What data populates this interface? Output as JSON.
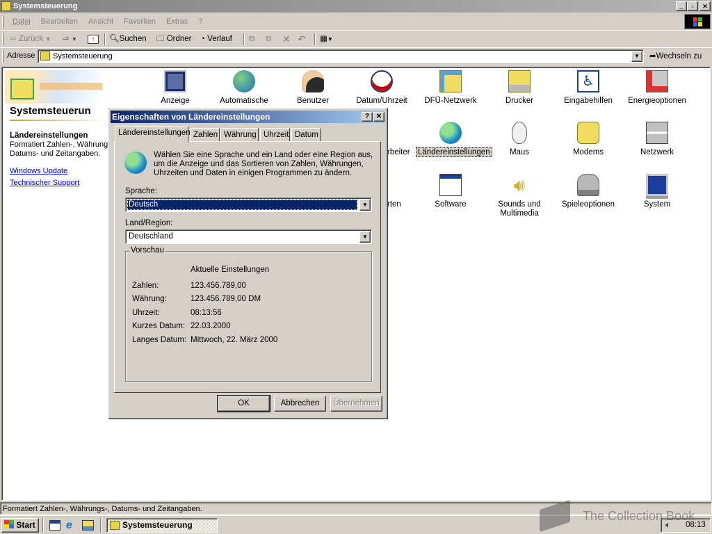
{
  "window": {
    "title": "Systemsteuerung"
  },
  "menu": [
    "Datei",
    "Bearbeiten",
    "Ansicht",
    "Favoriten",
    "Extras",
    "?"
  ],
  "toolbar": {
    "back": "Zurück",
    "search": "Suchen",
    "folders": "Ordner",
    "history": "Verlauf"
  },
  "address": {
    "label": "Adresse",
    "value": "Systemsteuerung",
    "go": "Wechseln zu"
  },
  "left_panel": {
    "title": "Systemsteuerun",
    "selected_name": "Ländereinstellungen",
    "selected_desc": "Formatiert Zahlen-, Währung Datums- und Zeitangaben.",
    "links": [
      "Windows Update",
      "Technischer Support"
    ]
  },
  "icons": [
    {
      "label": "Anzeige",
      "icon": "display-icon"
    },
    {
      "label": "Automatische Updates",
      "icon": "auto-updates-icon"
    },
    {
      "label": "Benutzer",
      "icon": "users-icon"
    },
    {
      "label": "Datum/Uhrzeit",
      "icon": "calendar-clock-icon"
    },
    {
      "label": "DFÜ-Netzwerk",
      "icon": "dialup-network-icon"
    },
    {
      "label": "Drucker",
      "icon": "printer-icon"
    },
    {
      "label": "Eingabehilfen",
      "icon": "accessibility-icon"
    },
    {
      "label": "Energieoptionen",
      "icon": "power-icon"
    },
    {
      "label": "…rbeiter",
      "icon": "hidden-icon"
    },
    {
      "label": "Ländereinstellungen",
      "icon": "globe-icon"
    },
    {
      "label": "Maus",
      "icon": "mouse-icon"
    },
    {
      "label": "Modems",
      "icon": "modem-icon"
    },
    {
      "label": "Netzwerk",
      "icon": "network-icon"
    },
    {
      "label": "…rten",
      "icon": "hidden-icon"
    },
    {
      "label": "Software",
      "icon": "software-icon"
    },
    {
      "label": "Sounds und Multimedia",
      "icon": "speaker-icon"
    },
    {
      "label": "Spieleoptionen",
      "icon": "joystick-icon"
    },
    {
      "label": "System",
      "icon": "computer-icon"
    }
  ],
  "dialog": {
    "title": "Eigenschaften von Ländereinstellungen",
    "tabs": [
      "Ländereinstellungen",
      "Zahlen",
      "Währung",
      "Uhrzeit",
      "Datum"
    ],
    "intro": "Wählen Sie eine Sprache und ein Land oder eine Region aus, um die Anzeige und das Sortieren von Zahlen, Währungen, Uhrzeiten und Daten in einigen Programmen zu ändern.",
    "language_label": "Sprache:",
    "language_value": "Deutsch",
    "region_label": "Land/Region:",
    "region_value": "Deutschland",
    "preview_label": "Vorschau",
    "preview_header": "Aktuelle Einstellungen",
    "preview_rows": [
      {
        "label": "Zahlen:",
        "value": "123.456.789,00"
      },
      {
        "label": "Währung:",
        "value": "123.456.789,00 DM"
      },
      {
        "label": "Uhrzeit:",
        "value": "08:13:56"
      },
      {
        "label": "Kurzes Datum:",
        "value": "22.03.2000"
      },
      {
        "label": "Langes Datum:",
        "value": "Mittwoch, 22. März 2000"
      }
    ],
    "ok": "OK",
    "cancel": "Abbrechen",
    "apply": "Übernehmen"
  },
  "statusbar": {
    "text": "Formatiert Zahlen-, Währungs-, Datums- und Zeitangaben."
  },
  "taskbar": {
    "start": "Start",
    "task": "Systemsteuerung",
    "clock": "08:13"
  },
  "watermark": "The Collection Book"
}
